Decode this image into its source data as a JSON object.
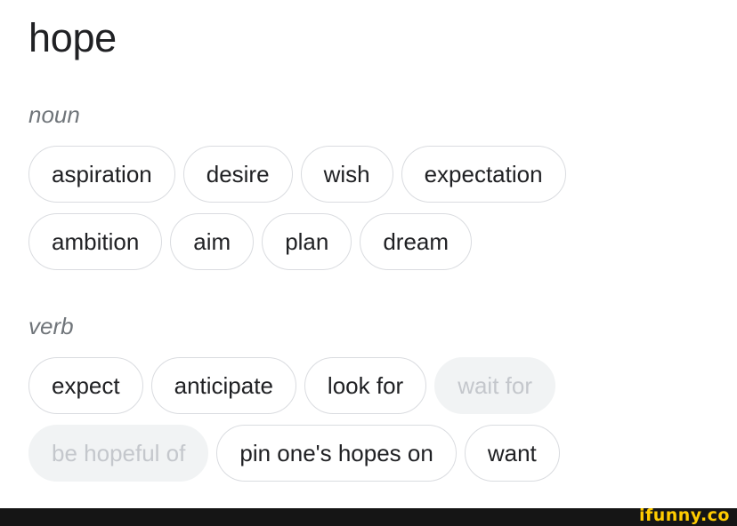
{
  "word": "hope",
  "sections": [
    {
      "part_of_speech": "noun",
      "rows": [
        [
          {
            "label": "aspiration",
            "muted": false
          },
          {
            "label": "desire",
            "muted": false
          },
          {
            "label": "wish",
            "muted": false
          },
          {
            "label": "expectation",
            "muted": false
          }
        ],
        [
          {
            "label": "ambition",
            "muted": false
          },
          {
            "label": "aim",
            "muted": false
          },
          {
            "label": "plan",
            "muted": false
          },
          {
            "label": "dream",
            "muted": false
          }
        ]
      ]
    },
    {
      "part_of_speech": "verb",
      "rows": [
        [
          {
            "label": "expect",
            "muted": false
          },
          {
            "label": "anticipate",
            "muted": false
          },
          {
            "label": "look for",
            "muted": false
          },
          {
            "label": "wait for",
            "muted": true
          }
        ],
        [
          {
            "label": "be hopeful of",
            "muted": true
          },
          {
            "label": "pin one's hopes on",
            "muted": false
          },
          {
            "label": "want",
            "muted": false
          }
        ]
      ]
    }
  ],
  "watermark": "ifunny.co",
  "colors": {
    "chip_border": "#dadce0",
    "muted_chip_bg": "#f1f3f4",
    "muted_text": "#c4c7cc",
    "pos_text": "#70757a",
    "watermark": "#ffcc00",
    "footer_bar": "#151515"
  }
}
